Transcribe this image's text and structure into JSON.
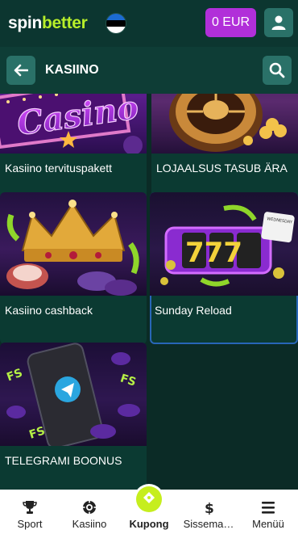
{
  "header": {
    "logo_spin": "spin",
    "logo_better": "better",
    "balance": "0 EUR"
  },
  "subheader": {
    "title": "KASIINO"
  },
  "cards": [
    {
      "label": "Kasiino tervituspakett",
      "image_text": "Casino"
    },
    {
      "label": "LOJAALSUS TASUB ÄRA"
    },
    {
      "label": "Kasiino cashback"
    },
    {
      "label": "Sunday Reload",
      "image_text": "777",
      "calendar_text": "WEDNESDAY"
    },
    {
      "label": "TELEGRAMI BOONUS",
      "image_text": "FS"
    }
  ],
  "bottom_nav": [
    {
      "label": "Sport",
      "icon": "trophy-icon"
    },
    {
      "label": "Kasiino",
      "icon": "casino-chip-icon"
    },
    {
      "label": "Kupong",
      "icon": "ticket-icon"
    },
    {
      "label": "Sissema…",
      "icon": "dollar-icon"
    },
    {
      "label": "Menüü",
      "icon": "menu-icon"
    }
  ],
  "colors": {
    "brand_green": "#b7ee2a",
    "balance_purple": "#b12fd9",
    "button_teal": "#2a7168",
    "background": "#0b2b26",
    "selected_border": "#2866b7"
  }
}
